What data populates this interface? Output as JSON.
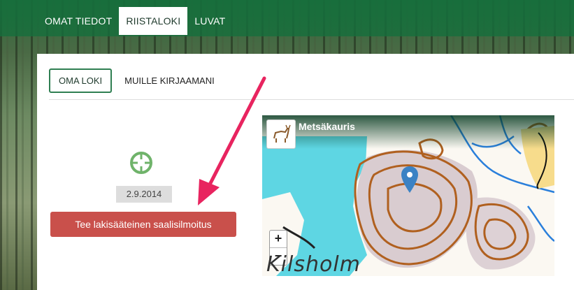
{
  "nav": {
    "items": [
      "OMAT TIEDOT",
      "RIISTALOKI",
      "LUVAT"
    ],
    "active_index": 1
  },
  "subtabs": {
    "active": "OMA LOKI",
    "other": "MUILLE KIRJAAMANI"
  },
  "entry": {
    "date": "2.9.2014",
    "report_button": "Tee lakisääteinen saalisilmoitus",
    "icon": "crosshair-icon"
  },
  "map": {
    "species": "Metsäkauris",
    "zoom_in": "+",
    "zoom_out": "−",
    "place": "Kilsholm"
  },
  "colors": {
    "brand_green": "#166e3c",
    "button_red": "#c9504b",
    "annotation_arrow": "#e8245f",
    "target_icon": "#6fb36a"
  }
}
